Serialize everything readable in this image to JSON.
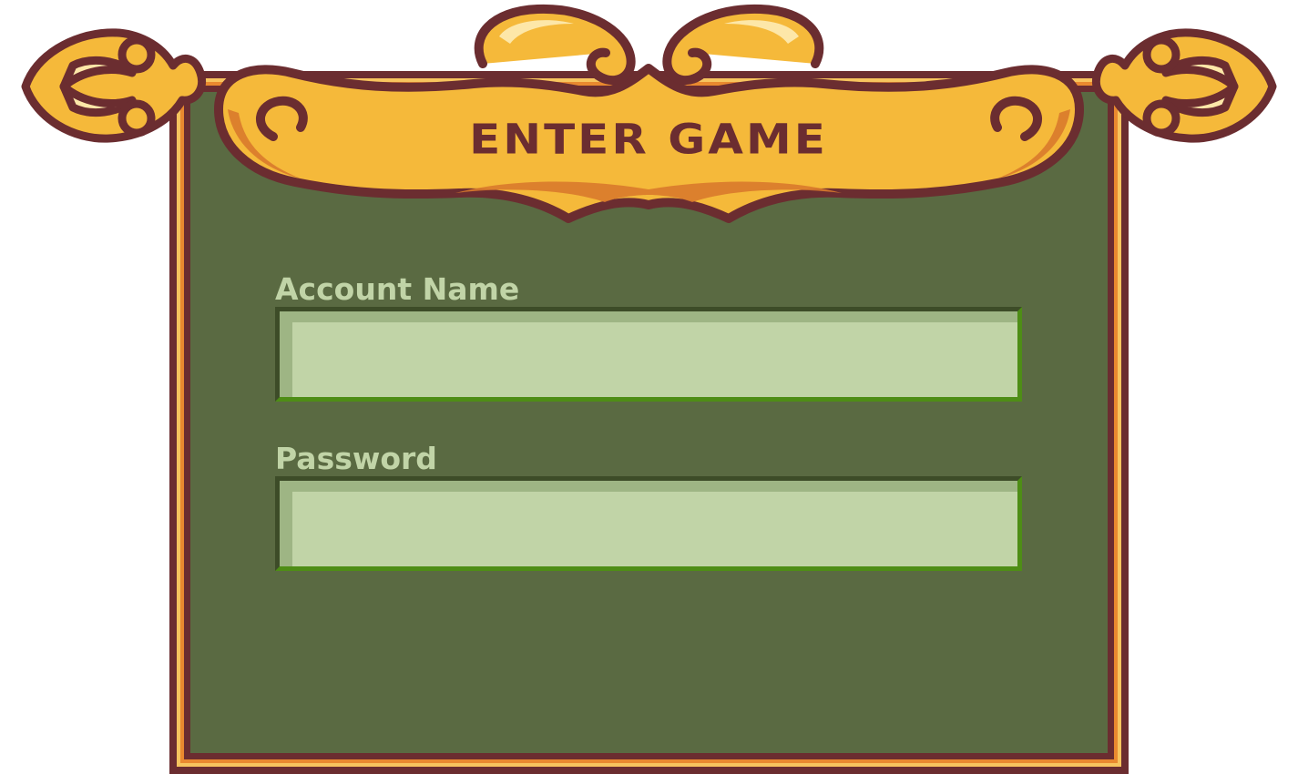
{
  "dialog": {
    "title": "ENTER GAME"
  },
  "form": {
    "account": {
      "label": "Account Name",
      "value": "",
      "placeholder": ""
    },
    "password": {
      "label": "Password",
      "value": "",
      "placeholder": ""
    }
  },
  "colors": {
    "frame_dark": "#6b2d30",
    "frame_gold": "#f7c45e",
    "frame_orange": "#e9892f",
    "panel_green": "#5a6a42",
    "field_fill": "#c1d4a7",
    "label_text": "#c1d4a7"
  },
  "icons": {
    "left_ornament": "fleur-ornament-icon",
    "right_ornament": "fleur-ornament-icon"
  }
}
